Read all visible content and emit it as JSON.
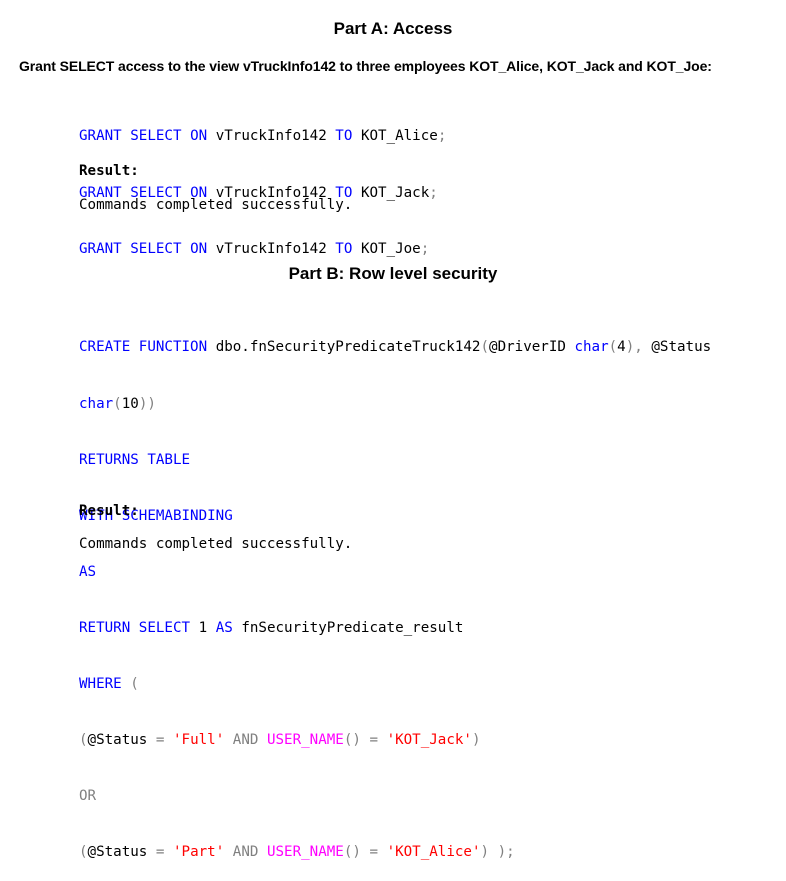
{
  "part_a": {
    "title": "Part A: Access",
    "instruction": "Grant SELECT access to the view vTruckInfo142 to three employees KOT_Alice, KOT_Jack and KOT_Joe:",
    "grants": [
      {
        "kw1": "GRANT",
        "kw2": "SELECT",
        "kw3": "ON",
        "object": "vTruckInfo142",
        "kw4": "TO",
        "user": "KOT_Alice",
        "semi": ";"
      },
      {
        "kw1": "GRANT",
        "kw2": "SELECT",
        "kw3": "ON",
        "object": "vTruckInfo142",
        "kw4": "TO",
        "user": "KOT_Jack",
        "semi": ";"
      },
      {
        "kw1": "GRANT",
        "kw2": "SELECT",
        "kw3": "ON",
        "object": "vTruckInfo142",
        "kw4": "TO",
        "user": "KOT_Joe",
        "semi": ";"
      }
    ],
    "result_label": "Result:",
    "result_text": "Commands completed successfully."
  },
  "part_b": {
    "title": "Part B: Row level security",
    "code": {
      "l1": {
        "create": "CREATE",
        "function": "FUNCTION",
        "name": "dbo.fnSecurityPredicateTruck142",
        "open": "(",
        "p1": "@DriverID",
        "t1": "char",
        "t1open": "(",
        "t1len": "4",
        "t1close": ")",
        "comma": ",",
        "p2": "@Status"
      },
      "l2": {
        "t2": "char",
        "t2open": "(",
        "t2len": "10",
        "t2close": "))"
      },
      "l3": "RETURNS TABLE",
      "l4": "WITH SCHEMABINDING",
      "l5": "AS",
      "l6": {
        "ret": "RETURN SELECT",
        "one": "1",
        "as": "AS",
        "alias": "fnSecurityPredicate_result"
      },
      "l7": {
        "where": "WHERE",
        "paren": "("
      },
      "l8": {
        "open": "(",
        "var": "@Status",
        "eq": "=",
        "str": "'Full'",
        "and": "AND",
        "fn": "USER_NAME",
        "fnparens": "()",
        "eq2": "=",
        "str2": "'KOT_Jack'",
        "close": ")"
      },
      "l9": "OR",
      "l10": {
        "open": "(",
        "var": "@Status",
        "eq": "=",
        "str": "'Part'",
        "and": "AND",
        "fn": "USER_NAME",
        "fnparens": "()",
        "eq2": "=",
        "str2": "'KOT_Alice'",
        "close": ") );"
      }
    },
    "result_label": "Result:",
    "result_text": "Commands completed successfully."
  }
}
